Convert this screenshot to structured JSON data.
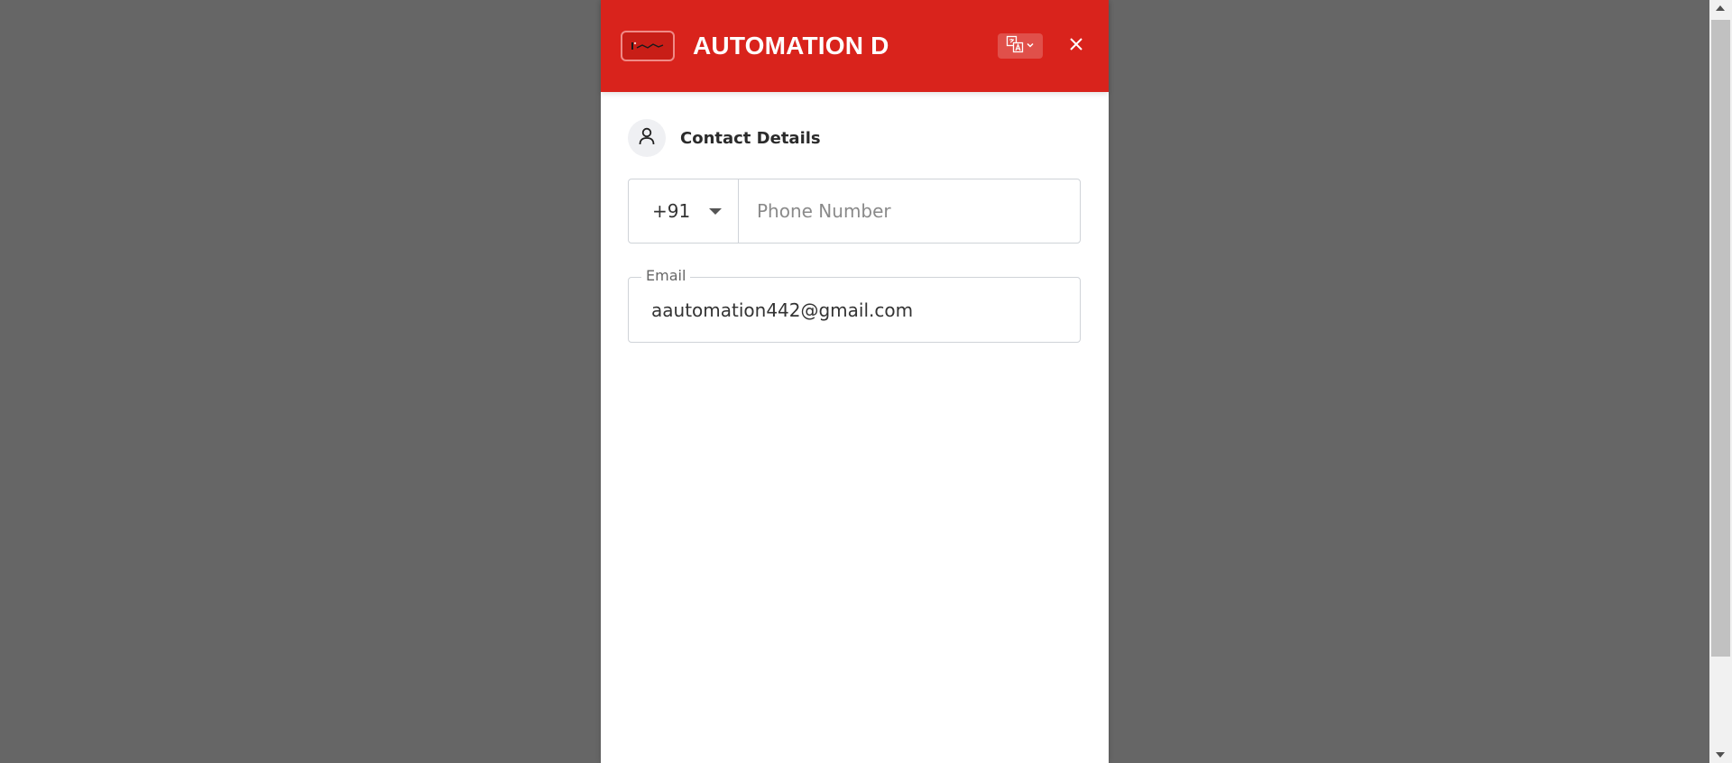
{
  "colors": {
    "header_bg": "#d9231c",
    "backdrop": "#666666",
    "panel_bg": "#ffffff"
  },
  "header": {
    "title": "AUTOMATION D",
    "logo_icon": "brand-logo-icon",
    "language_icon": "translate-icon",
    "close_icon": "close-icon"
  },
  "contact_section": {
    "title": "Contact Details",
    "icon": "user-icon"
  },
  "phone": {
    "country_code": "+91",
    "placeholder": "Phone Number",
    "value": ""
  },
  "email": {
    "label": "Email",
    "value": "aautomation442@gmail.com"
  }
}
